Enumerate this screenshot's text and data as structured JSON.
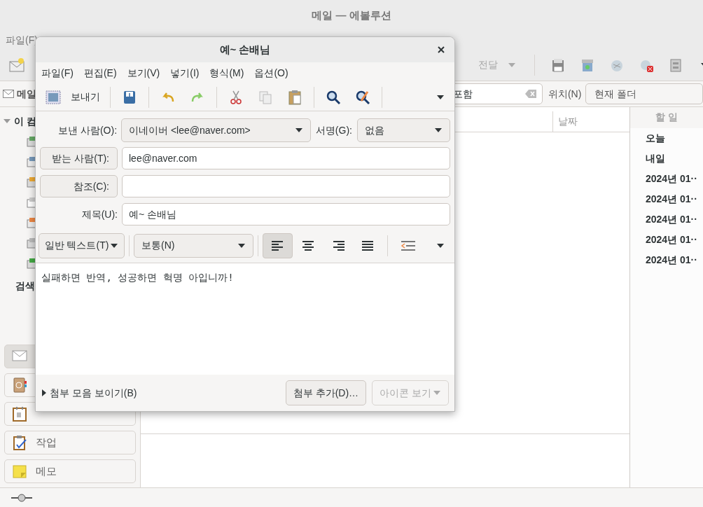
{
  "main_window": {
    "title": "메일 — 에볼루션",
    "menu": [
      "파일(F)"
    ],
    "toolbar": {
      "forward": {
        "label": "전달",
        "disabled": true
      }
    },
    "search": {
      "label": "메일",
      "query": "포함",
      "scope_label": "위치(N)",
      "scope": "현재 폴더"
    },
    "folder_tree": {
      "root": "이 컴",
      "expanded": true
    },
    "search_folders": "검색",
    "message_list": {
      "columns": [
        "날짜"
      ]
    },
    "todo": {
      "title": "할 일",
      "items": [
        {
          "label": "오늘"
        },
        {
          "label": "내일"
        },
        {
          "label": "2024년 01··"
        },
        {
          "label": "2024년 01··"
        },
        {
          "label": "2024년 01··"
        },
        {
          "label": "2024년 01··"
        },
        {
          "label": "2024년 01··"
        }
      ]
    },
    "switcher": [
      {
        "kind": "mail",
        "selected": true
      },
      {
        "kind": "contacts",
        "selected": false
      },
      {
        "kind": "calendar",
        "selected": false
      },
      {
        "kind": "tasks",
        "label": "작업",
        "selected": false
      },
      {
        "kind": "memos",
        "label": "메모",
        "selected": false
      }
    ]
  },
  "dialog": {
    "title": "예~ 손배님",
    "menu": [
      "파일(F)",
      "편집(E)",
      "보기(V)",
      "넣기(I)",
      "형식(M)",
      "옵션(O)"
    ],
    "toolbar": {
      "send": "보내기"
    },
    "from": {
      "label": "보낸 사람(O):",
      "value": "이네이버 <lee@naver.com>"
    },
    "signature": {
      "label": "서명(G):",
      "value": "없음"
    },
    "to": {
      "label": "받는 사람(T):",
      "value": "lee@naver.com"
    },
    "cc": {
      "label": "참조(C):"
    },
    "subject": {
      "label": "제목(U):",
      "value": "예~ 손배님"
    },
    "format": {
      "mode": "일반 텍스트(T)",
      "paragraph": "보통(N)",
      "alignment": [
        {
          "kind": "left",
          "selected": true
        },
        {
          "kind": "center",
          "selected": false
        },
        {
          "kind": "right",
          "selected": false
        },
        {
          "kind": "justify",
          "selected": false
        }
      ]
    },
    "body": "실패하면 반역, 성공하면 혁명 아입니까!",
    "attachments": {
      "toggle": "첨부 모음 보이기(B)",
      "expanded": false,
      "add": "첨부 추가(D)…",
      "view": {
        "label": "아이콘 보기",
        "disabled": true
      }
    }
  }
}
